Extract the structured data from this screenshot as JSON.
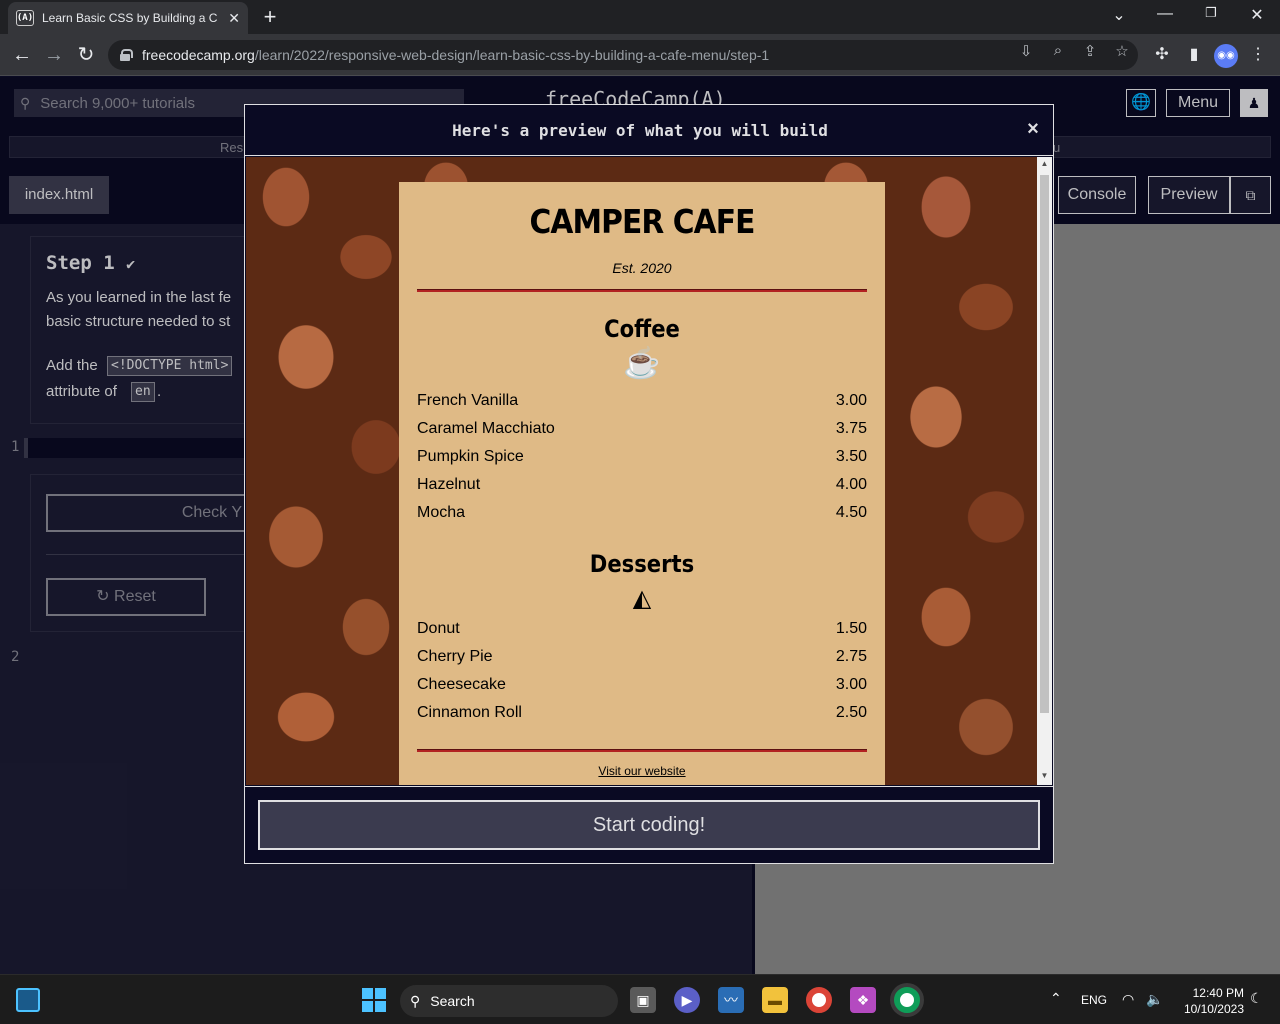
{
  "browser": {
    "tab_title": "Learn Basic CSS by Building a Ca",
    "tab_favicon": "(A)",
    "new_tab": "+",
    "url_host": "freecodecamp.org",
    "url_path": "/learn/2022/responsive-web-design/learn-basic-css-by-building-a-cafe-menu/step-1"
  },
  "fcc": {
    "search_placeholder": "Search 9,000+ tutorials",
    "logo": "freeCodeCamp(A)",
    "menu_label": "Menu",
    "breadcrumb_left": "Resp",
    "breadcrumb_right": "u",
    "file_tab": "index.html",
    "console_tab": "Console",
    "preview_tab": "Preview",
    "step_title": "Step 1",
    "instr_line1": "As you learned in the last fe",
    "instr_line2": "basic structure needed to st",
    "instr_add": "Add the",
    "instr_doctype": "<!DOCTYPE html>",
    "instr_attr": "attribute of",
    "instr_en": "en",
    "instr_period": ".",
    "line1": "1",
    "line2": "2",
    "check_label": "Check Y",
    "reset_label": "Reset"
  },
  "modal": {
    "title": "Here's a preview of what you will build",
    "close": "×",
    "start_button": "Start coding!"
  },
  "cafe": {
    "name": "CAMPER CAFE",
    "est": "Est. 2020",
    "coffee_heading": "Coffee",
    "desserts_heading": "Desserts",
    "coffee": [
      {
        "name": "French Vanilla",
        "price": "3.00"
      },
      {
        "name": "Caramel Macchiato",
        "price": "3.75"
      },
      {
        "name": "Pumpkin Spice",
        "price": "3.50"
      },
      {
        "name": "Hazelnut",
        "price": "4.00"
      },
      {
        "name": "Mocha",
        "price": "4.50"
      }
    ],
    "desserts": [
      {
        "name": "Donut",
        "price": "1.50"
      },
      {
        "name": "Cherry Pie",
        "price": "2.75"
      },
      {
        "name": "Cheesecake",
        "price": "3.00"
      },
      {
        "name": "Cinnamon Roll",
        "price": "2.50"
      }
    ],
    "footer_link": "Visit our website"
  },
  "taskbar": {
    "search_label": "Search",
    "language": "ENG",
    "time": "12:40 PM",
    "date": "10/10/2023"
  }
}
